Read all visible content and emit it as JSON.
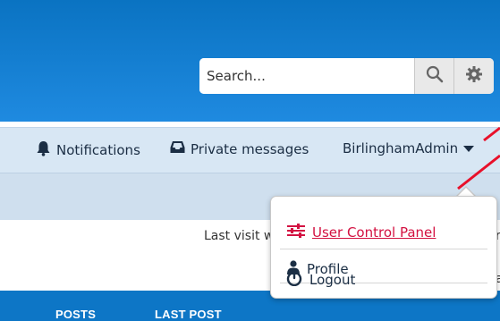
{
  "search": {
    "placeholder": "Search..."
  },
  "navbar": {
    "notifications_label": "Notifications",
    "private_messages_label": "Private messages",
    "username": "BirlinghamAdmin"
  },
  "main": {
    "last_visit_text": "Last visit wa",
    "peek_text_1": "r",
    "peek_text_2": "a"
  },
  "table_header": {
    "columns": [
      "POSTS",
      "LAST POST"
    ]
  },
  "dropdown": {
    "items": [
      {
        "label": "User Control Panel",
        "icon": "sliders-icon"
      },
      {
        "label": "Profile",
        "icon": "user-icon"
      },
      {
        "label": "Logout",
        "icon": "power-icon"
      }
    ]
  },
  "colors": {
    "header_blue": "#0a73c2",
    "navbar_bg": "#d8e7f4",
    "accent_red": "#d31141",
    "bottom_bar_blue": "#0d76c6"
  }
}
